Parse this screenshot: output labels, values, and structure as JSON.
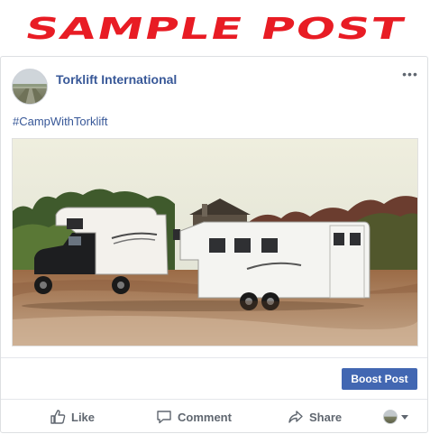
{
  "banner": {
    "text": "SAMPLE POST"
  },
  "post": {
    "page_name": "Torklift International",
    "text": "#CampWithTorklift",
    "photo_icon": "truck-camper-trailer-photo",
    "more_icon": "more-dots-icon"
  },
  "boost": {
    "label": "Boost Post"
  },
  "actions": {
    "like": "Like",
    "comment": "Comment",
    "share": "Share"
  },
  "colors": {
    "banner_red": "#e81c24",
    "link_blue": "#385898",
    "boost_blue": "#4267b2",
    "action_gray": "#606770"
  }
}
